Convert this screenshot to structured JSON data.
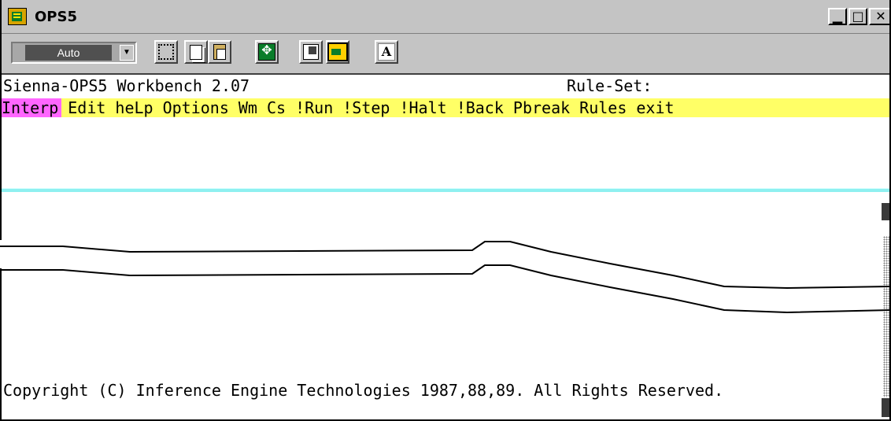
{
  "window": {
    "title": "OPS5",
    "controls": {
      "minimize": "▁",
      "maximize": "□",
      "close": "✕"
    }
  },
  "toolbar": {
    "combo_value": "Auto",
    "buttons": [
      {
        "name": "mark-icon"
      },
      {
        "name": "copy-icon"
      },
      {
        "name": "paste-icon"
      },
      {
        "name": "full-screen-icon"
      },
      {
        "name": "properties-icon"
      },
      {
        "name": "background-icon"
      },
      {
        "name": "font-icon",
        "glyph": "A"
      }
    ]
  },
  "console": {
    "header_left": "Sienna-OPS5 Workbench 2.07",
    "header_right": "Rule-Set:",
    "menu": [
      {
        "label": "Interp",
        "active": true
      },
      {
        "label": "Edit"
      },
      {
        "label": "heLp"
      },
      {
        "label": "Options"
      },
      {
        "label": "Wm"
      },
      {
        "label": "Cs"
      },
      {
        "label": "!Run"
      },
      {
        "label": "!Step"
      },
      {
        "label": "!Halt"
      },
      {
        "label": "!Back"
      },
      {
        "label": "Pbreak"
      },
      {
        "label": "Rules"
      },
      {
        "label": "exit"
      }
    ],
    "copyright": "Copyright (C) Inference Engine Technologies 1987,88,89. All Rights Reserved.",
    "colors": {
      "menu_bg": "#ffff66",
      "active_bg": "#ff66ff",
      "rule": "#8ef0f0"
    }
  }
}
